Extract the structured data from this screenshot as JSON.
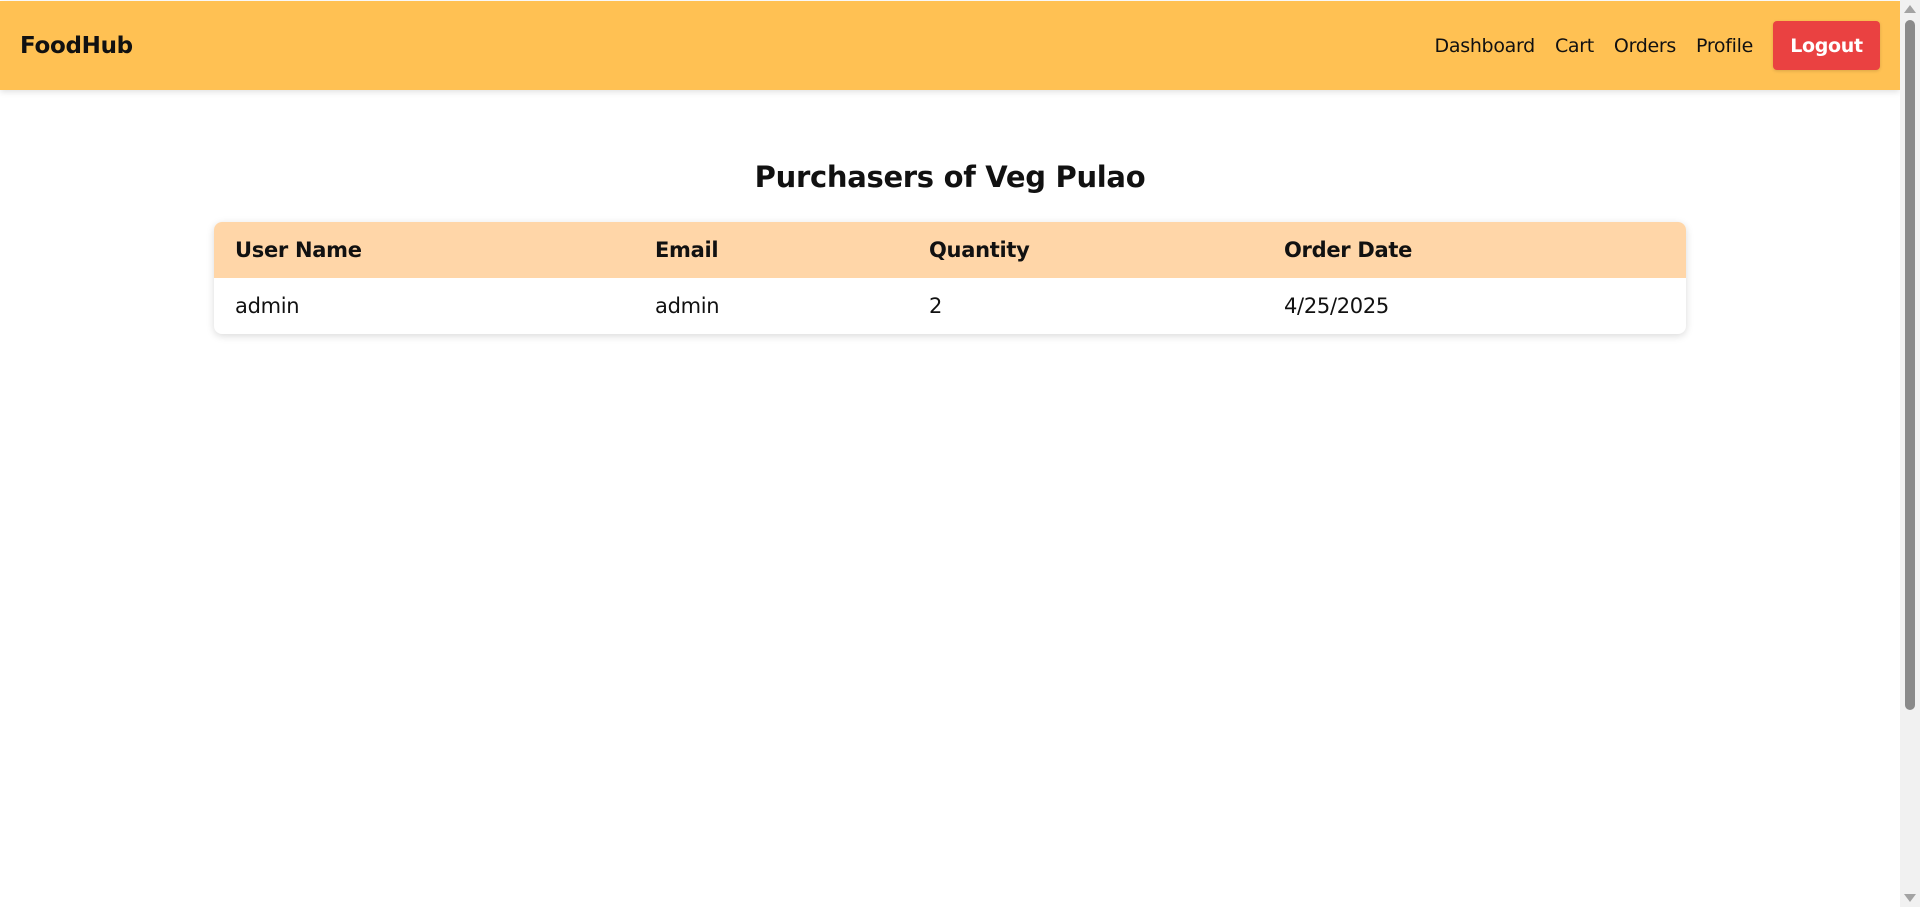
{
  "navbar": {
    "brand": "FoodHub",
    "links": [
      "Dashboard",
      "Cart",
      "Orders",
      "Profile"
    ],
    "logout_label": "Logout"
  },
  "main": {
    "title": "Purchasers of Veg Pulao",
    "table": {
      "headers": [
        "User Name",
        "Email",
        "Quantity",
        "Order Date"
      ],
      "rows": [
        [
          "admin",
          "admin",
          "2",
          "4/25/2025"
        ]
      ]
    }
  },
  "colors": {
    "navbar_bg": "#ffc153",
    "logout_bg": "#ea4141",
    "table_header_bg": "#ffd6a8"
  }
}
